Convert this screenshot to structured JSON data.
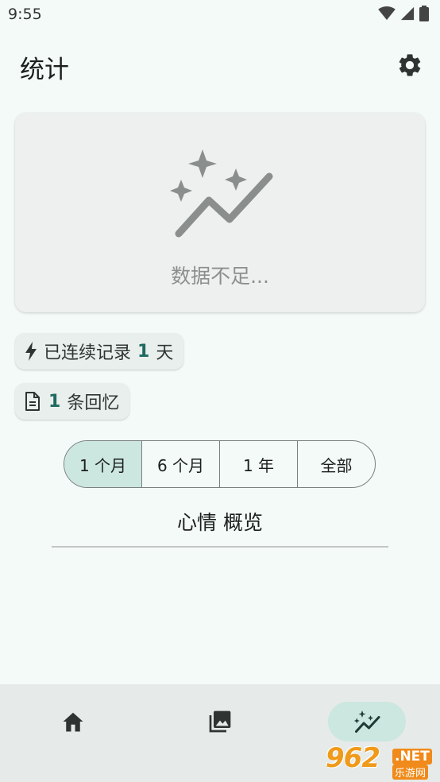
{
  "status_bar": {
    "time": "9:55"
  },
  "header": {
    "title": "统计"
  },
  "empty_state": {
    "message": "数据不足..."
  },
  "streak": {
    "prefix": "已连续记录",
    "count": "1",
    "suffix": "天"
  },
  "memories": {
    "count": "1",
    "suffix": "条回忆"
  },
  "range_tabs": [
    {
      "label": "1 个月",
      "selected": true
    },
    {
      "label": "6 个月",
      "selected": false
    },
    {
      "label": "1 年",
      "selected": false
    },
    {
      "label": "全部",
      "selected": false
    }
  ],
  "mood_section": {
    "title": "心情 概览"
  },
  "colors": {
    "accent": "#1f6a60",
    "selected_bg": "#cce6e0",
    "background": "#f3faf7"
  },
  "watermark": {
    "logo": "962",
    "net": ".NET",
    "sub": "乐游网"
  }
}
